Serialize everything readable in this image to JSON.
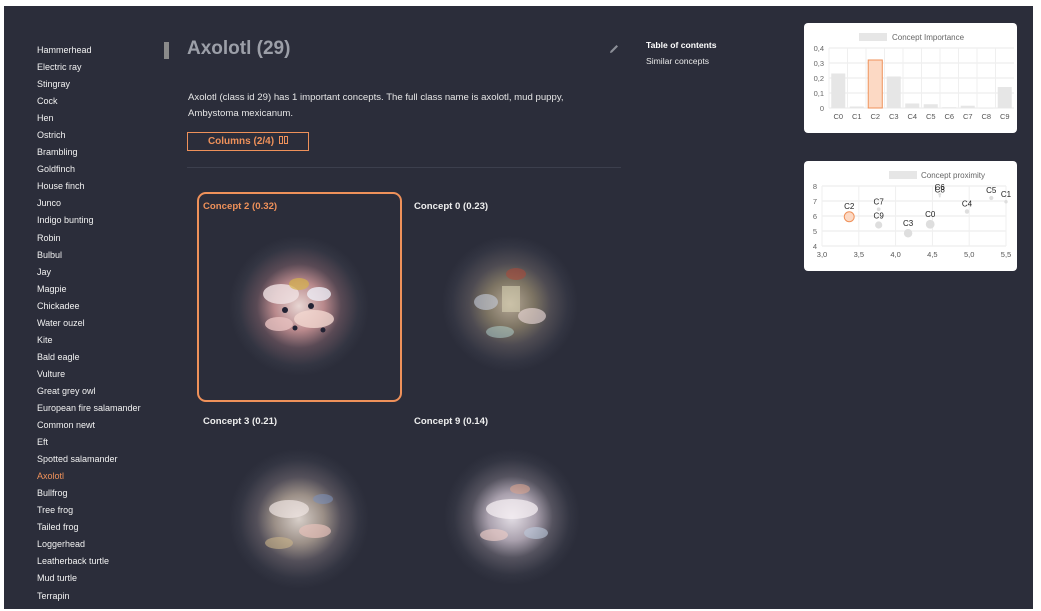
{
  "sidebar": {
    "items": [
      "Hammerhead",
      "Electric ray",
      "Stingray",
      "Cock",
      "Hen",
      "Ostrich",
      "Brambling",
      "Goldfinch",
      "House finch",
      "Junco",
      "Indigo bunting",
      "Robin",
      "Bulbul",
      "Jay",
      "Magpie",
      "Chickadee",
      "Water ouzel",
      "Kite",
      "Bald eagle",
      "Vulture",
      "Great grey owl",
      "European fire salamander",
      "Common newt",
      "Eft",
      "Spotted salamander",
      "Axolotl",
      "Bullfrog",
      "Tree frog",
      "Tailed frog",
      "Loggerhead",
      "Leatherback turtle",
      "Mud turtle",
      "Terrapin"
    ],
    "active": "Axolotl"
  },
  "page": {
    "title": "Axolotl (29)",
    "description": "Axolotl (class id 29) has 1 important concepts. The full class name is axolotl, mud puppy, Ambystoma mexicanum.",
    "columns_button": "Columns (2/4)"
  },
  "concepts": [
    {
      "label": "Concept 2 (0.32)",
      "selected": true
    },
    {
      "label": "Concept 0 (0.23)",
      "selected": false
    },
    {
      "label": "Concept 3 (0.21)",
      "selected": false
    },
    {
      "label": "Concept 9 (0.14)",
      "selected": false
    }
  ],
  "toc": {
    "title": "Table of contents",
    "items": [
      "Similar concepts"
    ]
  },
  "colors": {
    "accent": "#ef915a",
    "background": "#2b2d3a",
    "bar_default": "#e6e6e6",
    "bar_highlight": "#fcd9c4"
  },
  "chart_data": [
    {
      "type": "bar",
      "title": "Concept Importance",
      "categories": [
        "C0",
        "C1",
        "C2",
        "C3",
        "C4",
        "C5",
        "C6",
        "C7",
        "C8",
        "C9"
      ],
      "values": [
        0.23,
        0.01,
        0.32,
        0.21,
        0.03,
        0.025,
        0.005,
        0.015,
        0.0,
        0.14
      ],
      "highlight": "C2",
      "ylim": [
        0,
        0.4
      ],
      "yticks": [
        "0",
        "0,1",
        "0,2",
        "0,3",
        "0,4"
      ],
      "grid": true,
      "legend": "top"
    },
    {
      "type": "scatter",
      "title": "Concept proximity",
      "points": [
        {
          "label": "C2",
          "x": 3.37,
          "y": 5.95,
          "size": 0.32,
          "highlight": true
        },
        {
          "label": "C7",
          "x": 3.77,
          "y": 6.45,
          "size": 0.015
        },
        {
          "label": "C9",
          "x": 3.77,
          "y": 5.4,
          "size": 0.14
        },
        {
          "label": "C3",
          "x": 4.17,
          "y": 4.85,
          "size": 0.21
        },
        {
          "label": "C0",
          "x": 4.47,
          "y": 5.45,
          "size": 0.23
        },
        {
          "label": "C4",
          "x": 4.97,
          "y": 6.3,
          "size": 0.03
        },
        {
          "label": "C6",
          "x": 4.6,
          "y": 7.45,
          "size": 0.005
        },
        {
          "label": "C8",
          "x": 4.6,
          "y": 7.3,
          "size": 0.0
        },
        {
          "label": "C5",
          "x": 5.3,
          "y": 7.2,
          "size": 0.025
        },
        {
          "label": "C1",
          "x": 5.5,
          "y": 6.95,
          "size": 0.01
        }
      ],
      "xlim": [
        3.0,
        5.5
      ],
      "ylim": [
        4,
        8
      ],
      "xticks": [
        "3,0",
        "3,5",
        "4,0",
        "4,5",
        "5,0",
        "5,5"
      ],
      "yticks": [
        "4",
        "5",
        "6",
        "7",
        "8"
      ],
      "grid": true,
      "legend": "top"
    }
  ]
}
